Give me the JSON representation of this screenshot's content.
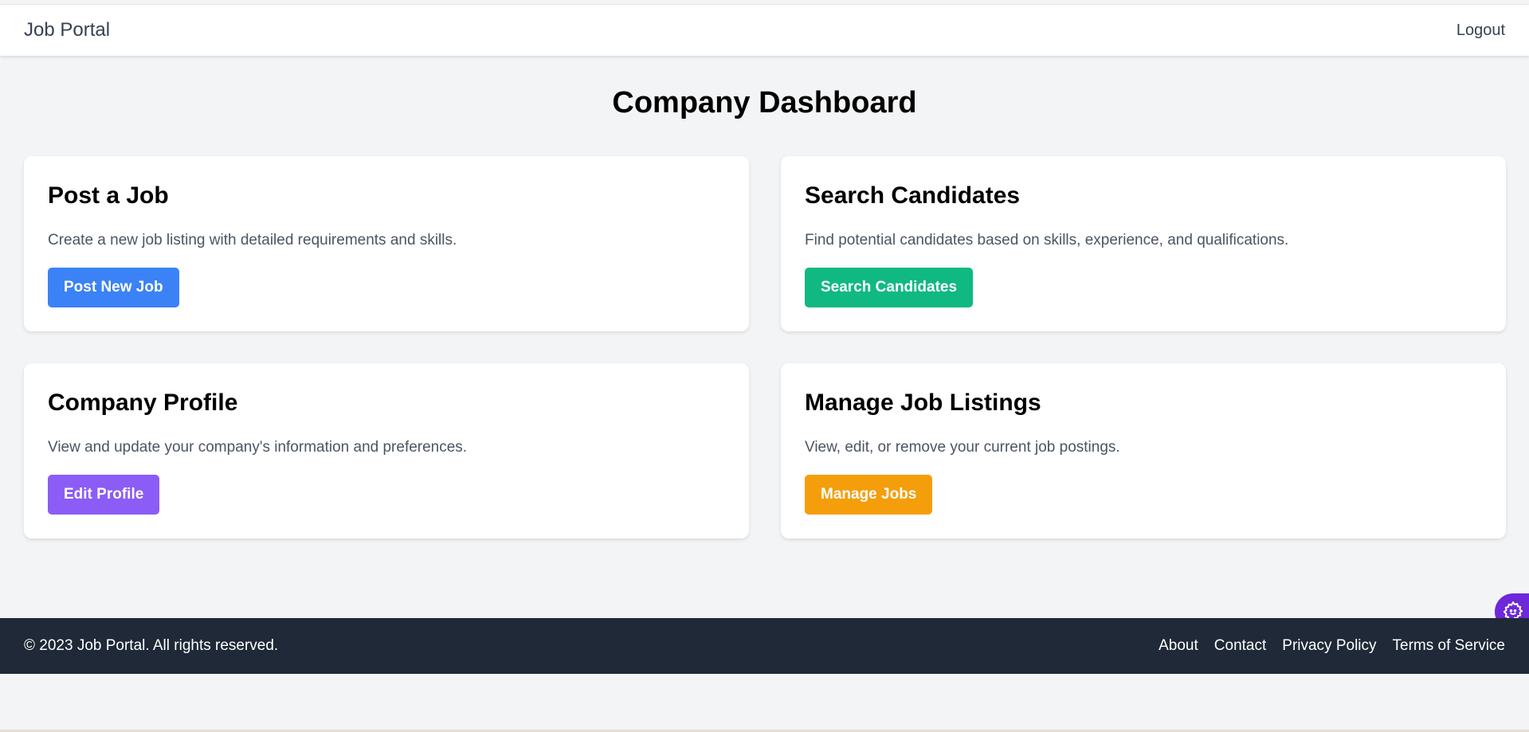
{
  "navbar": {
    "brand": "Job Portal",
    "logout": "Logout"
  },
  "main": {
    "title": "Company Dashboard",
    "cards": [
      {
        "title": "Post a Job",
        "description": "Create a new job listing with detailed requirements and skills.",
        "button_label": "Post New Job",
        "button_color": "#3b82f6"
      },
      {
        "title": "Search Candidates",
        "description": "Find potential candidates based on skills, experience, and qualifications.",
        "button_label": "Search Candidates",
        "button_color": "#10b981"
      },
      {
        "title": "Company Profile",
        "description": "View and update your company's information and preferences.",
        "button_label": "Edit Profile",
        "button_color": "#8b5cf6"
      },
      {
        "title": "Manage Job Listings",
        "description": "View, edit, or remove your current job postings.",
        "button_label": "Manage Jobs",
        "button_color": "#f59e0b"
      }
    ]
  },
  "footer": {
    "copyright": "© 2023 Job Portal. All rights reserved.",
    "links": [
      "About",
      "Contact",
      "Privacy Policy",
      "Terms of Service"
    ]
  },
  "floating_widget": {
    "icon": "gear-icon",
    "color": "#6d28d9"
  }
}
